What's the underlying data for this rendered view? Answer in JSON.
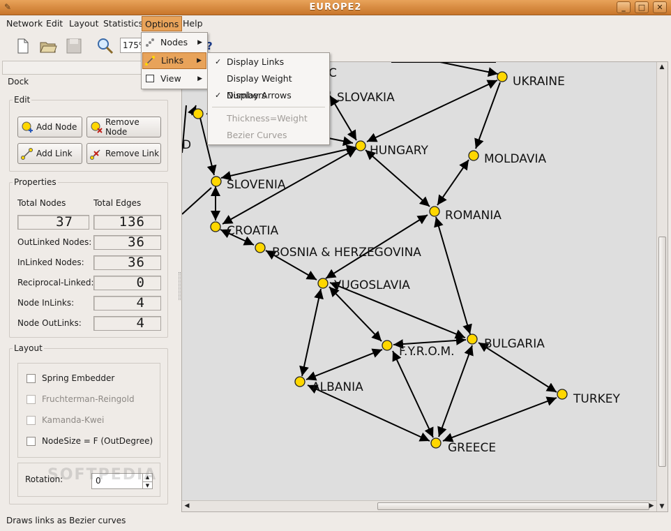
{
  "window": {
    "title": "EUROPE2",
    "colors": {
      "titlebar": "#d8883c",
      "highlight": "#e8a35a",
      "node": "#ffd700"
    }
  },
  "menubar": [
    "Network",
    "Edit",
    "Layout",
    "Statistics",
    "Options",
    "Help"
  ],
  "toolbar": {
    "zoom": "175%"
  },
  "dock": {
    "title": "Dock",
    "edit": {
      "title": "Edit",
      "add_node": "Add Node",
      "remove_node": "Remove Node",
      "add_link": "Add Link",
      "remove_link": "Remove Link"
    },
    "properties": {
      "title": "Properties",
      "total_nodes_label": "Total Nodes",
      "total_edges_label": "Total Edges",
      "total_nodes": "37",
      "total_edges": "136",
      "rows": [
        {
          "label": "OutLinked Nodes:",
          "value": "36"
        },
        {
          "label": "InLinked Nodes:",
          "value": "36"
        },
        {
          "label": "Reciprocal-Linked:",
          "value": "0"
        },
        {
          "label": "Node InLinks:",
          "value": "4"
        },
        {
          "label": "Node OutLinks:",
          "value": "4"
        }
      ]
    },
    "layout": {
      "title": "Layout",
      "options": [
        {
          "label": "Spring Embedder",
          "enabled": true
        },
        {
          "label": "Fruchterman-Reingold",
          "enabled": false
        },
        {
          "label": "Kamanda-Kwei",
          "enabled": false
        },
        {
          "label": "NodeSize = F (OutDegree)",
          "enabled": true
        }
      ],
      "rotation_label": "Rotation:",
      "rotation": "0"
    }
  },
  "options_menu": {
    "items": [
      {
        "label": "Nodes"
      },
      {
        "label": "Links"
      },
      {
        "label": "View"
      }
    ],
    "links_submenu": [
      {
        "label": "Display Links",
        "checked": true,
        "enabled": true
      },
      {
        "label": "Display Weight Numbers",
        "checked": false,
        "enabled": true
      },
      {
        "label": "Display Arrows",
        "checked": true,
        "enabled": true
      },
      {
        "label": "Thickness=Weight",
        "checked": false,
        "enabled": false
      },
      {
        "label": "Bezier Curves",
        "checked": false,
        "enabled": false
      }
    ]
  },
  "graph": {
    "nodes": [
      "UKRAINE",
      "SLOVAKIA",
      "HUNGARY",
      "MOLDAVIA",
      "SLOVENIA",
      "ROMANIA",
      "CROATIA",
      "BOSNIA & HERZEGOVINA",
      "YUGOSLAVIA",
      "BULGARIA",
      "F.Y.R.O.M.",
      "ALBANIA",
      "TURKEY",
      "GREECE"
    ],
    "partial_labels": [
      "C",
      "D"
    ]
  },
  "status": "Draws links as Bezier curves"
}
